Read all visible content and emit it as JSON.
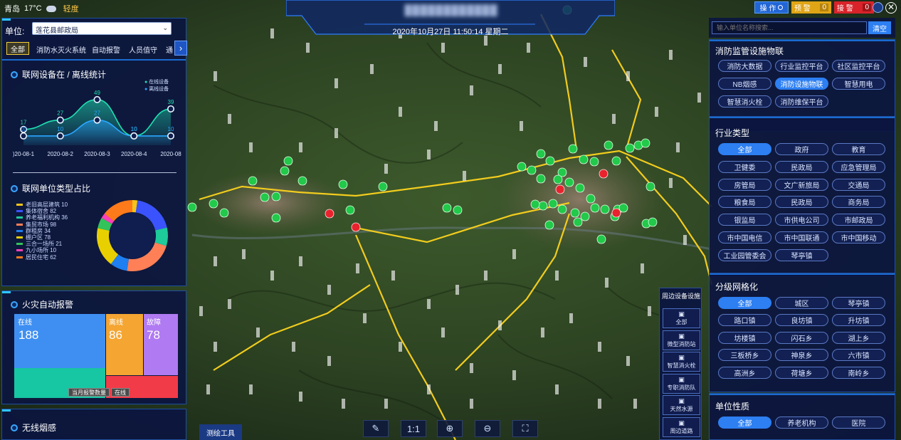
{
  "weather": {
    "city": "青岛",
    "temp": "17°C",
    "air": "轻度"
  },
  "header": {
    "title_blurred": "████████████",
    "datetime": "2020年10月27日 11:50:14 星期二"
  },
  "top_right": {
    "operate": "操 作",
    "warn": "预 警",
    "warn_count": "0",
    "alarm": "接 警",
    "alarm_count": "0"
  },
  "unit": {
    "label": "单位:",
    "value": "莲花县邮政局"
  },
  "tabs": [
    "全部",
    "消防水灭火系统",
    "自动报警",
    "人员值守",
    "通"
  ],
  "online_chart": {
    "title": "联网设备在 / 离线统计",
    "legend": [
      "在线设备",
      "离线设备"
    ]
  },
  "chart_data": {
    "type": "area",
    "title": "联网设备在 / 离线统计",
    "categories": [
      "2020-08-1",
      "2020-08-2",
      "2020-08-3",
      "2020-08-4",
      "2020-08"
    ],
    "tick_labels": [
      ")20-08-1",
      "2020-08-2",
      "2020-08-3",
      "2020-08-4",
      "2020-08"
    ],
    "series": [
      {
        "name": "在线设备",
        "values": [
          17,
          27,
          49,
          10,
          39
        ],
        "color": "#1fe0b0"
      },
      {
        "name": "离线设备",
        "values": [
          10,
          10,
          27,
          10,
          10
        ],
        "color": "#2aa7ff"
      }
    ],
    "ylim": [
      0,
      55
    ]
  },
  "donut": {
    "title": "联网单位类型占比",
    "items": [
      {
        "label": "老旧高层建筑 10",
        "value": 10,
        "color": "#f5c518"
      },
      {
        "label": "集体宿舍 82",
        "value": 82,
        "color": "#3a53ff"
      },
      {
        "label": "养老福利机构 36",
        "value": 36,
        "color": "#1ec99a"
      },
      {
        "label": "集贸市场 98",
        "value": 98,
        "color": "#ff7f57"
      },
      {
        "label": "群租房 34",
        "value": 34,
        "color": "#1d7ff0"
      },
      {
        "label": "棚户区 78",
        "value": 78,
        "color": "#e8d000"
      },
      {
        "label": "三合一场所 21",
        "value": 21,
        "color": "#33c35b"
      },
      {
        "label": "九小场所 10",
        "value": 10,
        "color": "#ff3fb8"
      },
      {
        "label": "居民住宅 62",
        "value": 62,
        "color": "#ff7a1a"
      }
    ]
  },
  "fire_alarm": {
    "title": "火灾自动报警",
    "online_label": "在线",
    "online_value": "188",
    "offline_label": "离线",
    "offline_value": "86",
    "fault_label": "故障",
    "fault_value": "78",
    "breadcrumb_a": "当月报警数量",
    "breadcrumb_b": "在线"
  },
  "wireless": {
    "title": "无线烟感"
  },
  "side_tools": {
    "title": "周边设备设施",
    "items": [
      {
        "label": "全部",
        "icon": "clipboard-icon"
      },
      {
        "label": "微型消防站",
        "icon": "firefighter-icon"
      },
      {
        "label": "智慧消火栓",
        "icon": "hydrant-icon"
      },
      {
        "label": "专职消防队",
        "icon": "truck-icon"
      },
      {
        "label": "天然水源",
        "icon": "water-pin-icon"
      },
      {
        "label": "周边道路",
        "icon": "road-icon"
      }
    ]
  },
  "bottom_tools": {
    "measure": "测绘工具",
    "ratio": "1:1"
  },
  "search": {
    "placeholder": "输入单位名称搜索...",
    "clear": "清空"
  },
  "right_sections": {
    "iot": {
      "title": "消防监管设施物联",
      "buttons": [
        "消防大数据",
        "行业监控平台",
        "社区监控平台",
        "NB烟感",
        "消防设施物联",
        "智慧用电",
        "智慧消火栓",
        "消防维保平台"
      ],
      "active": 4
    },
    "industry": {
      "title": "行业类型",
      "buttons": [
        "全部",
        "政府",
        "教育",
        "卫健委",
        "民政局",
        "应急管理局",
        "房管局",
        "文广新旅局",
        "交通局",
        "粮食局",
        "民政局",
        "商务局",
        "银监局",
        "市供电公司",
        "市邮政局",
        "市中国电信",
        "市中国联通",
        "市中国移动",
        "工业园管委会",
        "琴亭镇"
      ],
      "active": 0
    },
    "grid": {
      "title": "分级网格化",
      "buttons": [
        "全部",
        "城区",
        "琴亭镇",
        "路口镇",
        "良坊镇",
        "升坊镇",
        "坊楼镇",
        "闪石乡",
        "湖上乡",
        "三板桥乡",
        "神泉乡",
        "六市镇",
        "高洲乡",
        "荷塘乡",
        "南岭乡"
      ],
      "active": 0
    },
    "nature": {
      "title": "单位性质",
      "buttons": [
        "全部",
        "养老机构",
        "医院"
      ],
      "active": 0
    }
  }
}
